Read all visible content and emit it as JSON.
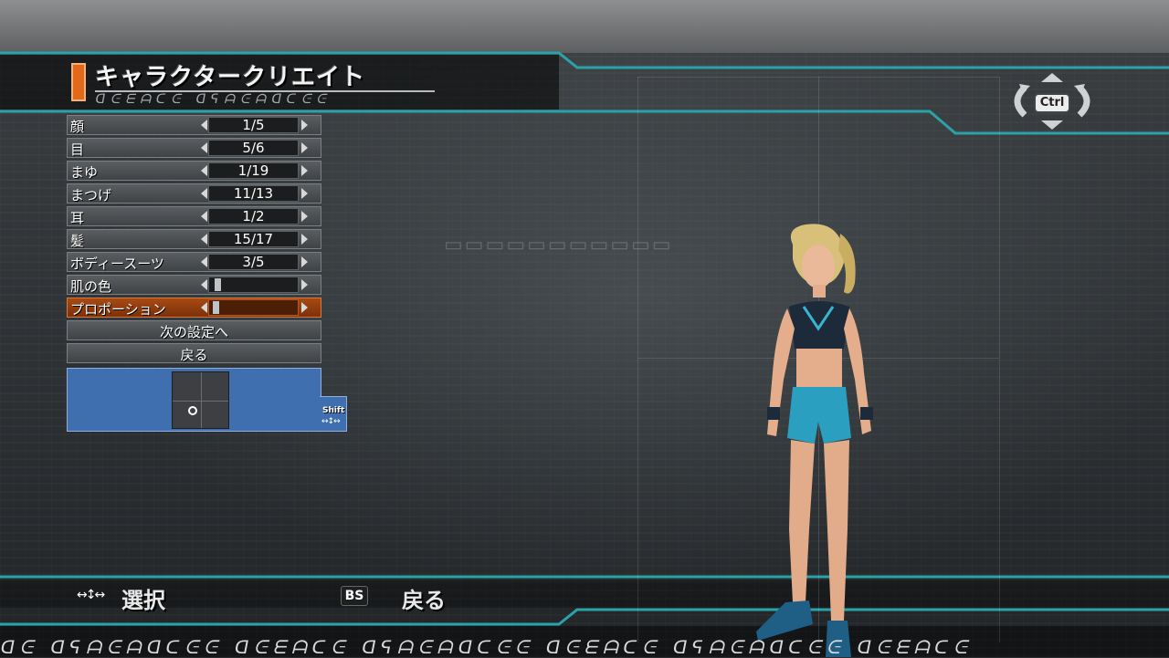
{
  "title": "キャラクタークリエイト",
  "subtitle": "ᗡᕮᗴᗩᑕᕮ ᗡᕋᗩᕮᗩᗡᑕᕮᕮ",
  "menu": {
    "rows": [
      {
        "label": "顔",
        "value": "1/5"
      },
      {
        "label": "目",
        "value": "5/6"
      },
      {
        "label": "まゆ",
        "value": "1/19"
      },
      {
        "label": "まつげ",
        "value": "11/13"
      },
      {
        "label": "耳",
        "value": "1/2"
      },
      {
        "label": "髪",
        "value": "15/17"
      },
      {
        "label": "ボディースーツ",
        "value": "3/5"
      }
    ],
    "sliders": [
      {
        "label": "肌の色",
        "level": 0.05
      },
      {
        "label": "プロポーション",
        "level": 0.03,
        "selected": true
      }
    ],
    "next_label": "次の設定へ",
    "back_label": "戻る"
  },
  "shift_key": "Shift",
  "ctrl_key": "Ctrl",
  "hints": {
    "select": "選択",
    "bs_key": "BS",
    "back": "戻る"
  },
  "bottom_deco": "ᗡᕮ ᗡᕋᗩᕮᗩᗡᑕᕮᕮ ᗡᕮᗴᗩᑕᕮ ᗡᕋᗩᕮᗩᗡᑕᕮᕮ ᗡᕮᗴᗩᑕᕮ ᗡᕋᗩᕮᗩᗡᑕᕮᕮ ᗡᕮᗴᗩᑕᕮ",
  "colors": {
    "accent_orange": "#e06a1a",
    "frame_teal": "#2aa3a8",
    "pad_blue": "#3f6fae",
    "selected_row": "#a64a14"
  }
}
